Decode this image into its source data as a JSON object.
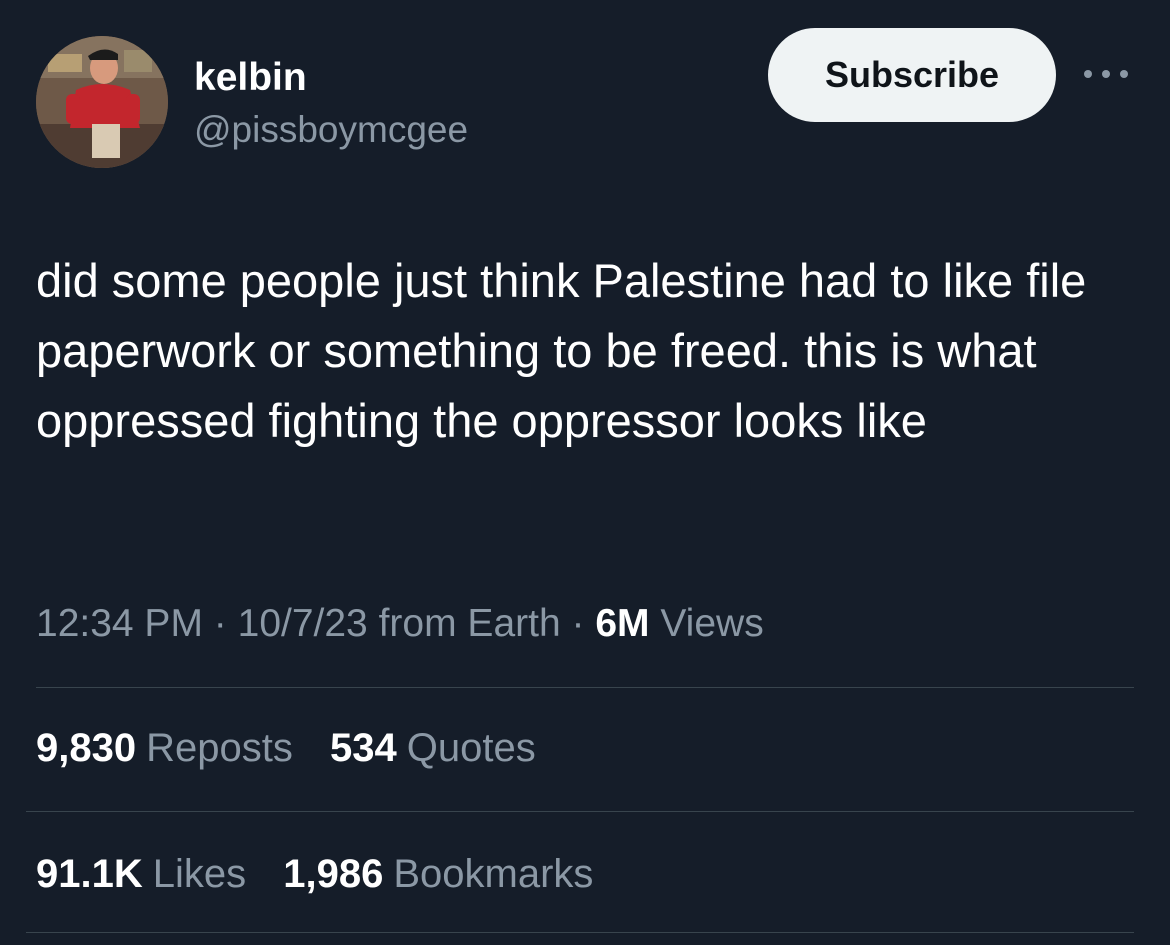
{
  "profile": {
    "display_name": "kelbin",
    "handle": "@pissboymcgee"
  },
  "actions": {
    "subscribe_label": "Subscribe",
    "more_icon": "more-horizontal-icon"
  },
  "tweet": {
    "text": "did some people just think Palestine had to like file paperwork or something to be freed. this is what oppressed fighting the oppressor looks like"
  },
  "meta": {
    "time": "12:34 PM",
    "separator1": "·",
    "date": "10/7/23",
    "from": "from Earth",
    "separator2": "·",
    "views_count": "6M",
    "views_label": "Views"
  },
  "stats": {
    "reposts": {
      "value": "9,830",
      "label": "Reposts"
    },
    "quotes": {
      "value": "534",
      "label": "Quotes"
    },
    "likes": {
      "value": "91.1K",
      "label": "Likes"
    },
    "bookmarks": {
      "value": "1,986",
      "label": "Bookmarks"
    }
  },
  "colors": {
    "background": "#151d29",
    "primary_text": "#ffffff",
    "secondary_text": "#8b98a5",
    "button_bg": "#eff3f4",
    "divider": "#38444d"
  }
}
